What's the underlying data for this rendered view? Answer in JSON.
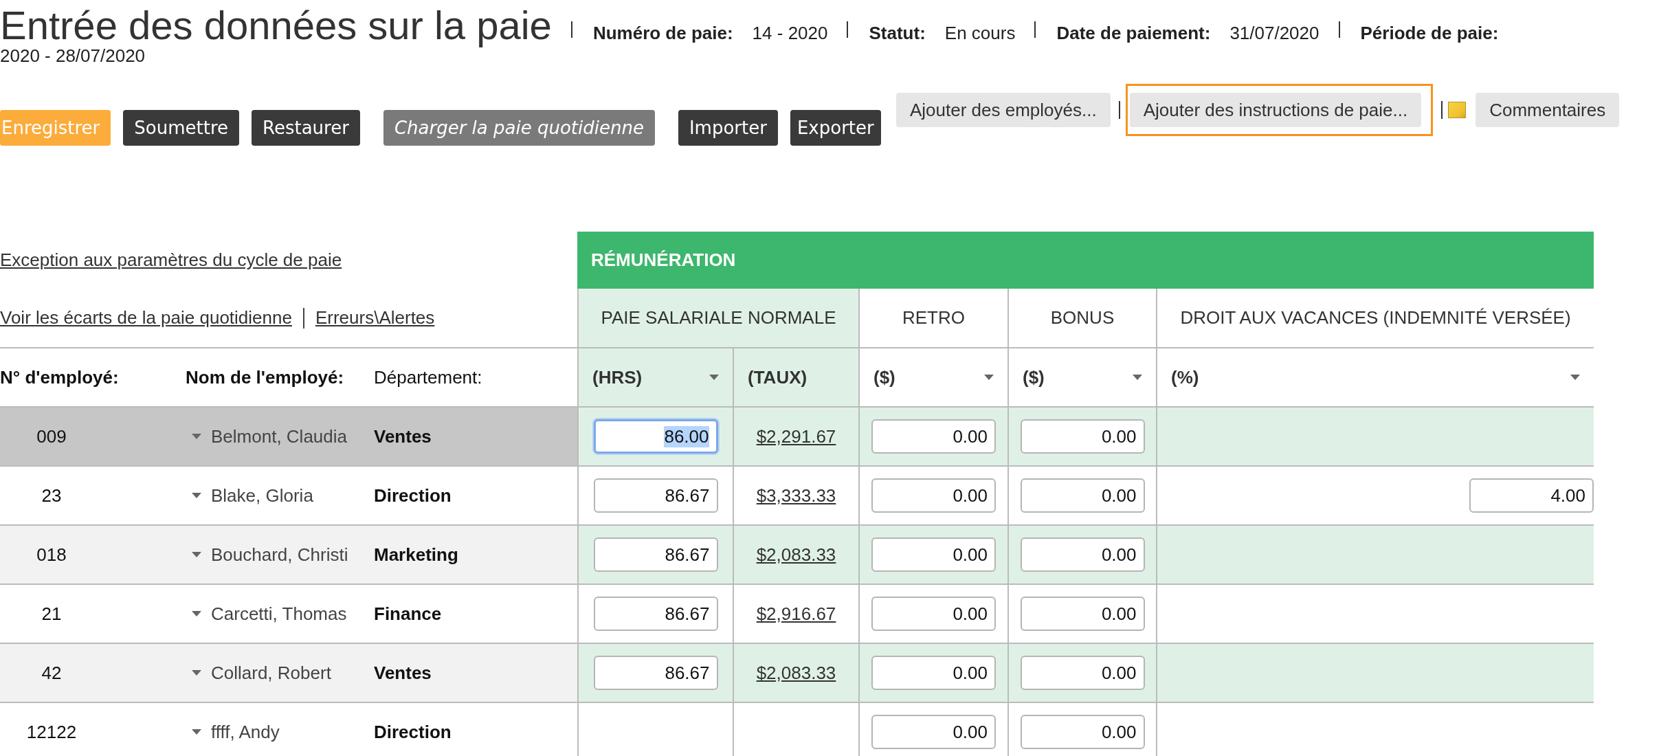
{
  "header": {
    "title": "Entrée des données sur la paie",
    "fields": [
      {
        "label": "Numéro de paie:",
        "value": "14 - 2020"
      },
      {
        "label": "Statut:",
        "value": "En cours"
      },
      {
        "label": "Date de paiement:",
        "value": "31/07/2020"
      },
      {
        "label": "Période de paie:",
        "value": "2020 - 28/07/2020"
      }
    ]
  },
  "actions": [
    {
      "label": "Enregistrer",
      "kind": "primary"
    },
    {
      "label": "Soumettre",
      "kind": "dark"
    },
    {
      "label": "Restaurer",
      "kind": "dark"
    },
    {
      "label": "Charger la paie quotidienne",
      "kind": "disabled"
    },
    {
      "label": "Importer",
      "kind": "dark"
    },
    {
      "label": "Exporter",
      "kind": "dark"
    }
  ],
  "tools": [
    {
      "label": "Ajouter des employés...",
      "kind": "button",
      "highlighted": false
    },
    {
      "label": "Ajouter des instructions de paie...",
      "kind": "button",
      "highlighted": true
    },
    {
      "label": "Commentaires",
      "kind": "note",
      "highlighted": false
    }
  ],
  "links": {
    "top": "Exception aux paramètres du cycle de paie",
    "bottom": [
      "Voir les écarts de la paie quotidienne",
      "Erreurs\\Alertes"
    ]
  },
  "table": {
    "section": "RÉMUNÉRATION",
    "left_columns": [
      {
        "label": "N° d'employé:",
        "bold": true
      },
      {
        "label": "Nom de l'employé:",
        "bold": true
      },
      {
        "label": "Département:",
        "bold": false
      }
    ],
    "groups": [
      {
        "label": "PAIE SALARIALE NORMALE",
        "tinted": true,
        "units": [
          {
            "label": "(HRS)",
            "menu": true
          },
          {
            "label": "(TAUX)",
            "menu": false
          }
        ]
      },
      {
        "label": "RETRO",
        "tinted": false,
        "units": [
          {
            "label": "($)",
            "menu": true
          }
        ]
      },
      {
        "label": "BONUS",
        "tinted": false,
        "units": [
          {
            "label": "($)",
            "menu": true
          }
        ]
      },
      {
        "label": "DROIT AUX VACANCES (INDEMNITÉ VERSÉE)",
        "tinted": false,
        "units": [
          {
            "label": "(%)",
            "menu": true
          }
        ]
      }
    ],
    "rows": [
      {
        "number": "009",
        "name": "Belmont, Claudia",
        "department": "Ventes",
        "selected": true,
        "cells": [
          {
            "kind": "input",
            "value": "86.00",
            "focused": true
          },
          {
            "kind": "link",
            "value": "$2,291.67"
          },
          {
            "kind": "input",
            "value": "0.00",
            "focused": false
          },
          {
            "kind": "input",
            "value": "0.00",
            "focused": false
          },
          {
            "kind": "empty"
          }
        ]
      },
      {
        "number": "23",
        "name": "Blake, Gloria",
        "department": "Direction",
        "selected": false,
        "cells": [
          {
            "kind": "input",
            "value": "86.67",
            "focused": false
          },
          {
            "kind": "link",
            "value": "$3,333.33"
          },
          {
            "kind": "input",
            "value": "0.00",
            "focused": false
          },
          {
            "kind": "input",
            "value": "0.00",
            "focused": false
          },
          {
            "kind": "input",
            "value": "4.00",
            "focused": false
          }
        ]
      },
      {
        "number": "018",
        "name": "Bouchard, Christi",
        "department": "Marketing",
        "selected": false,
        "cells": [
          {
            "kind": "input",
            "value": "86.67",
            "focused": false
          },
          {
            "kind": "link",
            "value": "$2,083.33"
          },
          {
            "kind": "input",
            "value": "0.00",
            "focused": false
          },
          {
            "kind": "input",
            "value": "0.00",
            "focused": false
          },
          {
            "kind": "empty"
          }
        ]
      },
      {
        "number": "21",
        "name": "Carcetti, Thomas",
        "department": "Finance",
        "selected": false,
        "cells": [
          {
            "kind": "input",
            "value": "86.67",
            "focused": false
          },
          {
            "kind": "link",
            "value": "$2,916.67"
          },
          {
            "kind": "input",
            "value": "0.00",
            "focused": false
          },
          {
            "kind": "input",
            "value": "0.00",
            "focused": false
          },
          {
            "kind": "empty"
          }
        ]
      },
      {
        "number": "42",
        "name": "Collard, Robert",
        "department": "Ventes",
        "selected": false,
        "cells": [
          {
            "kind": "input",
            "value": "86.67",
            "focused": false
          },
          {
            "kind": "link",
            "value": "$2,083.33"
          },
          {
            "kind": "input",
            "value": "0.00",
            "focused": false
          },
          {
            "kind": "input",
            "value": "0.00",
            "focused": false
          },
          {
            "kind": "empty"
          }
        ]
      },
      {
        "number": "12122",
        "name": "ffff, Andy",
        "department": "Direction",
        "selected": false,
        "cells": [
          {
            "kind": "empty"
          },
          {
            "kind": "empty"
          },
          {
            "kind": "input",
            "value": "0.00",
            "focused": false
          },
          {
            "kind": "input",
            "value": "0.00",
            "focused": false
          },
          {
            "kind": "empty"
          }
        ]
      }
    ]
  }
}
